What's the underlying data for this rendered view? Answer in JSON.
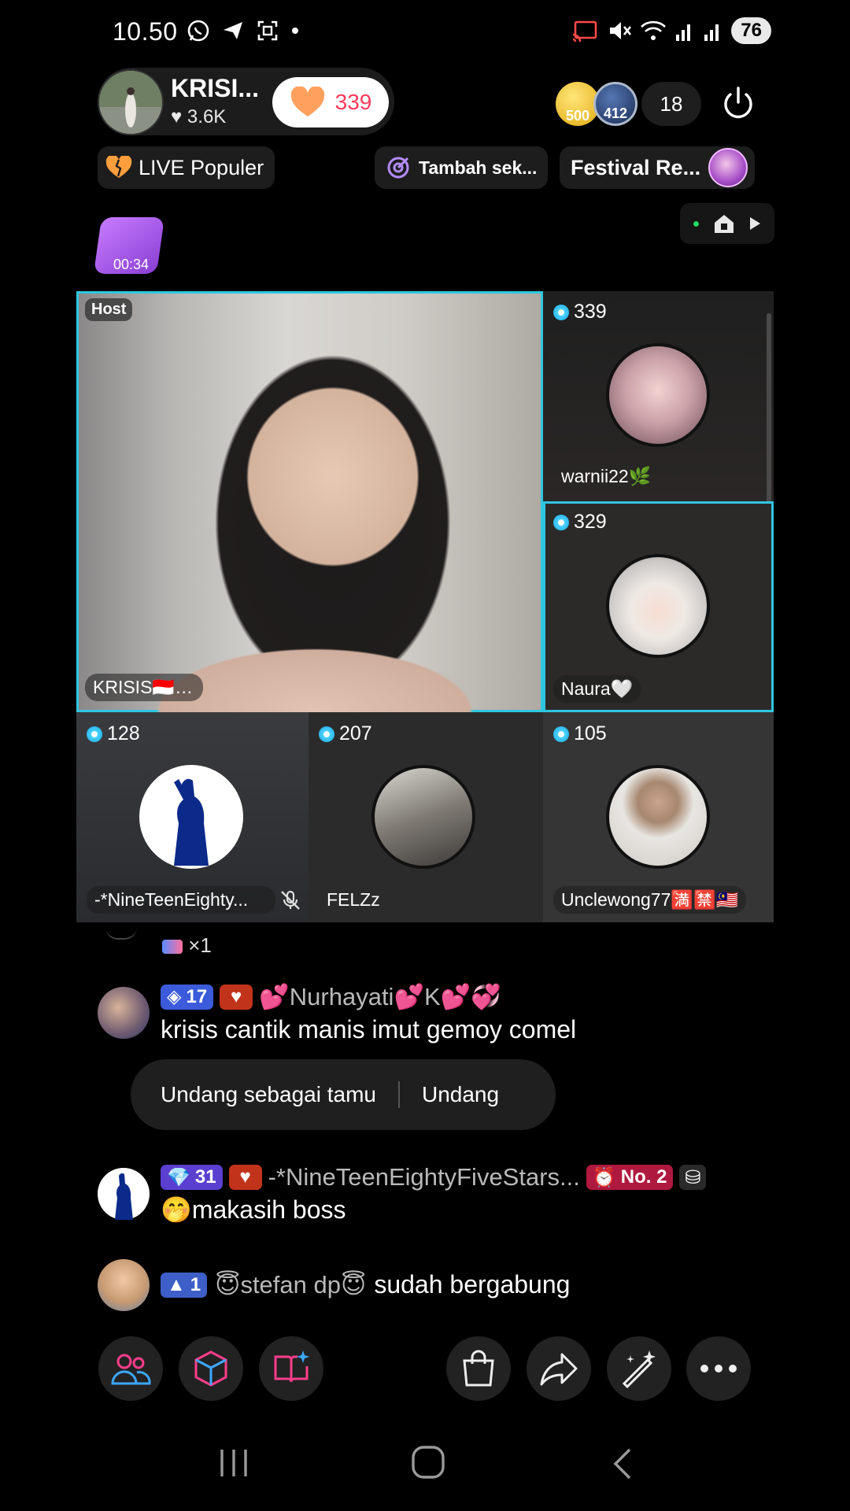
{
  "status_bar": {
    "time": "10.50",
    "battery": "76"
  },
  "host": {
    "name": "KRISI...",
    "likes": "3.6K",
    "follow_count": "339"
  },
  "top_right": {
    "coin1_value": "500",
    "coin2_value": "412",
    "viewer_count": "18"
  },
  "pills": {
    "live_populer": "LIVE Populer",
    "tambah": "Tambah sek...",
    "festival": "Festival Re..."
  },
  "gift_timer": "00:34",
  "grid": {
    "host_label": "Host",
    "host_name": "KRISIS🇮🇩🇮🇩",
    "guests": [
      {
        "score": "339",
        "name": "warnii22🌿"
      },
      {
        "score": "329",
        "name": "Naura🤍"
      },
      {
        "score": "128",
        "name": "-*NineTeenEighty..."
      },
      {
        "score": "207",
        "name": "FELZz"
      },
      {
        "score": "105",
        "name": "Unclewong77🈵🈲🇲🇾"
      }
    ]
  },
  "chat": {
    "partial_gift": "×1",
    "messages": [
      {
        "level": "17",
        "name": "💕Nurhayati💕K💕💞",
        "text": "krisis cantik manis imut gemoy comel"
      },
      {
        "level": "31",
        "name": "-*NineTeenEightyFiveStars...",
        "rank": "No. 2",
        "text": "🤭makasih boss"
      },
      {
        "level": "1",
        "name": "😇stefan dp😇",
        "text": "sudah bergabung"
      }
    ]
  },
  "invite": {
    "as_guest": "Undang sebagai tamu",
    "invite": "Undang"
  },
  "colors": {
    "accent_cyan": "#2fc6e0",
    "follow_red": "#ff3b5c",
    "tool_pink": "#ff3d8a"
  }
}
